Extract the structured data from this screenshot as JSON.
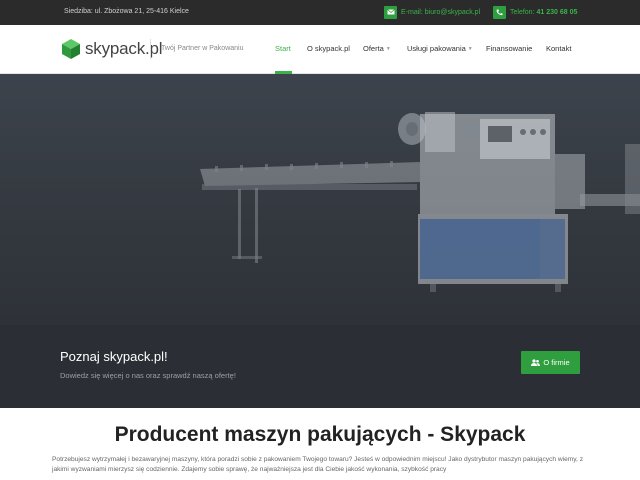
{
  "topbar": {
    "address": "Siedziba: ul. Zbożowa 21, 25-416 Kielce",
    "email_label": "E-mail:",
    "email_value": "biuro@skypack.pl",
    "phone_label": "Telefon:",
    "phone_value": "41 230 68 05",
    "icon_names": [
      "email-icon",
      "phone-icon"
    ]
  },
  "header": {
    "logo_text": "skypack.pl",
    "tagline": "Twój Partner w Pakowaniu",
    "nav": [
      {
        "label": "Start",
        "active": true
      },
      {
        "label": "O skypack.pl",
        "active": false
      },
      {
        "label": "Oferta",
        "active": false,
        "dropdown": true
      },
      {
        "label": "Usługi pakowania",
        "active": false,
        "dropdown": true
      },
      {
        "label": "Finansowanie",
        "active": false
      },
      {
        "label": "Kontakt",
        "active": false
      }
    ]
  },
  "band": {
    "title": "Poznaj skypack.pl!",
    "subtitle": "Dowiedz się więcej o nas oraz sprawdź naszą ofertę!",
    "button_label": "O firmie"
  },
  "content": {
    "title": "Producent maszyn pakujących - Skypack",
    "paragraph": "Potrzebujesz wytrzymałej i bezawaryjnej maszyny, która poradzi sobie z pakowaniem Twojego towaru? Jesteś w odpowiednim miejscu! Jako dystrybutor maszyn pakujących wiemy, z jakimi wyzwaniami mierzysz się codziennie. Zdajemy sobie sprawę, że najważniejsza jest dla Ciebie jakość wykonania, szybkość pracy"
  },
  "colors": {
    "accent": "#3ab34a",
    "button": "#2e9e3e",
    "topbar": "#2b2b2b",
    "band": "#2b2f35"
  }
}
